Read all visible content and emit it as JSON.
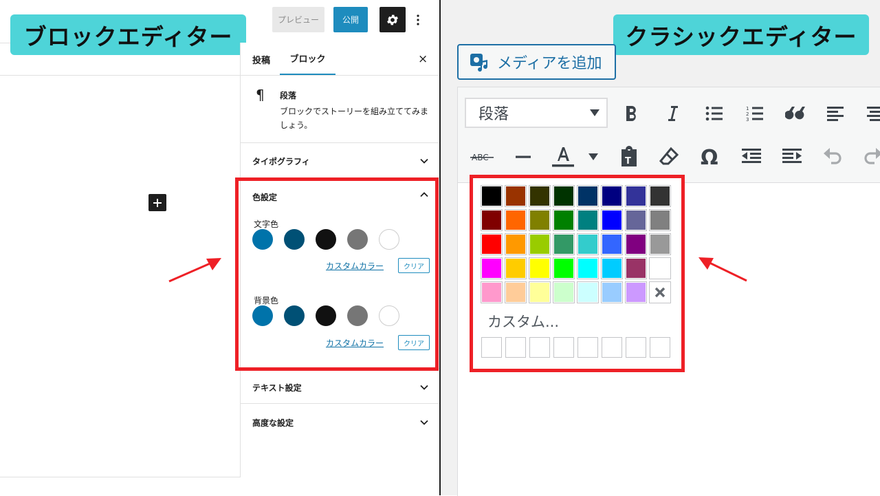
{
  "block_editor": {
    "label": "ブロックエディター",
    "toolbar": {
      "preview_label": "プレビュー",
      "publish_label": "公開"
    },
    "sidebar": {
      "tabs": [
        {
          "label": "投稿",
          "active": false
        },
        {
          "label": "ブロック",
          "active": true
        }
      ],
      "close_symbol": "×",
      "block_card": {
        "icon": "¶",
        "title": "段落",
        "description": "ブロックでストーリーを組み立ててみましょう。"
      },
      "panels": {
        "typography": {
          "title": "タイポグラフィ",
          "expanded": false
        },
        "color": {
          "title": "色設定",
          "expanded": true,
          "text_color": {
            "label": "文字色",
            "custom_label": "カスタムカラー",
            "clear_label": "クリア"
          },
          "background_color": {
            "label": "背景色",
            "custom_label": "カスタムカラー",
            "clear_label": "クリア"
          },
          "swatches": [
            "#0073aa",
            "#005075",
            "#111111",
            "#767676",
            "#ffffff"
          ]
        },
        "text_settings": {
          "title": "テキスト設定",
          "expanded": false
        },
        "advanced": {
          "title": "高度な設定",
          "expanded": false
        }
      }
    }
  },
  "classic_editor": {
    "label": "クラシックエディター",
    "media_button": "メディアを追加",
    "format_select": "段落",
    "picker": {
      "colors": [
        [
          "#000000",
          "#993300",
          "#333300",
          "#003300",
          "#003366",
          "#000080",
          "#333399",
          "#333333"
        ],
        [
          "#800000",
          "#ff6600",
          "#808000",
          "#008000",
          "#008080",
          "#0000ff",
          "#666699",
          "#808080"
        ],
        [
          "#ff0000",
          "#ff9900",
          "#99cc00",
          "#339966",
          "#33cccc",
          "#3366ff",
          "#800080",
          "#999999"
        ],
        [
          "#ff00ff",
          "#ffcc00",
          "#ffff00",
          "#00ff00",
          "#00ffff",
          "#00ccff",
          "#993366",
          "#ffffff"
        ],
        [
          "#ff99cc",
          "#ffcc99",
          "#ffff99",
          "#ccffcc",
          "#ccffff",
          "#99ccff",
          "#cc99ff",
          "none"
        ]
      ],
      "custom_label": "カスタム..."
    }
  },
  "colors": {
    "accent": "#1e8cbe",
    "highlight": "#ee2026",
    "label_bg": "#4ed4d8"
  }
}
